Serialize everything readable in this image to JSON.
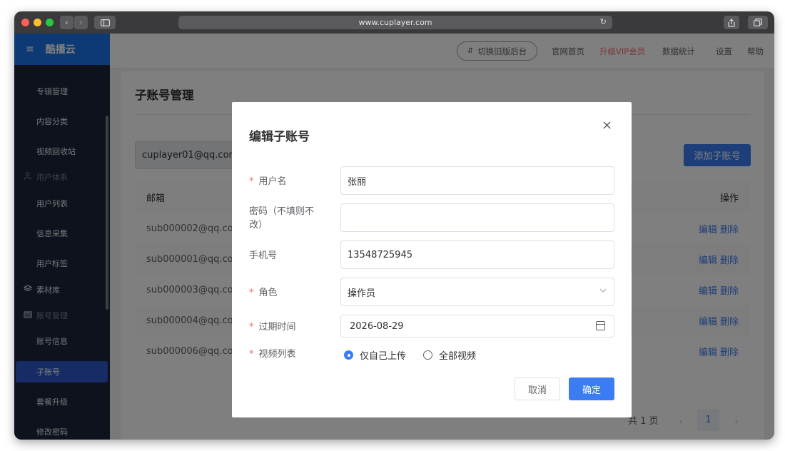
{
  "browser": {
    "url": "www.cuplayer.com",
    "back": "‹",
    "forward": "›"
  },
  "app": {
    "brand": "酷播云",
    "menu_icon": "≡"
  },
  "topnav": {
    "switch_label": "切换旧版后台",
    "links": [
      {
        "label": "官网首页",
        "color": "#606266"
      },
      {
        "label": "升级VIP会员",
        "color": "#f56c6c"
      },
      {
        "label": "数据统计",
        "color": "#606266"
      },
      {
        "label": "设置",
        "color": "#606266"
      },
      {
        "label": "帮助",
        "color": "#606266"
      }
    ]
  },
  "sidebar": {
    "items": [
      {
        "label": "专辑管理"
      },
      {
        "label": "内容分类"
      },
      {
        "label": "视频回收站"
      },
      {
        "label": "用户体系",
        "group": true
      },
      {
        "label": "用户列表"
      },
      {
        "label": "信息采集"
      },
      {
        "label": "用户标签"
      },
      {
        "label": "素材库",
        "group": true
      },
      {
        "label": "账号管理",
        "group": true
      },
      {
        "label": "账号信息"
      },
      {
        "label": "子账号",
        "active": true
      },
      {
        "label": "套餐升级"
      },
      {
        "label": "修改密码"
      }
    ]
  },
  "page": {
    "title": "子账号管理",
    "search_value": "cuplayer01@qq.com",
    "add_button": "添加子账号",
    "table": {
      "headers": [
        "邮箱",
        "操作"
      ],
      "rows": [
        {
          "email": "sub000002@qq.com",
          "edit": "编辑",
          "delete": "删除"
        },
        {
          "email": "sub000001@qq.com",
          "edit": "编辑",
          "delete": "删除"
        },
        {
          "email": "sub000003@qq.com",
          "edit": "编辑",
          "delete": "删除"
        },
        {
          "email": "sub000004@qq.com",
          "edit": "编辑",
          "delete": "删除"
        },
        {
          "email": "sub000006@qq.com",
          "edit": "编辑",
          "delete": "删除"
        }
      ]
    },
    "pager": {
      "total": "共 1 页",
      "current": "1",
      "prev": "‹",
      "next": "›"
    }
  },
  "modal": {
    "title": "编辑子账号",
    "close": "×",
    "fields": {
      "username": {
        "label": "用户名",
        "value": "张丽",
        "required": "*"
      },
      "password": {
        "label": "密码（不填则不改）",
        "label_line1": "密码（不填则不",
        "label_line2": "改）",
        "value": ""
      },
      "phone": {
        "label": "手机号",
        "value": "13548725945"
      },
      "role": {
        "label": "角色",
        "value": "操作员",
        "required": "*"
      },
      "expire": {
        "label": "过期时间",
        "value": "2026-08-29",
        "required": "*"
      },
      "videos": {
        "label": "视频列表",
        "required": "*",
        "options": [
          "仅自己上传",
          "全部视频"
        ],
        "selected": "仅自己上传"
      }
    },
    "cancel": "取消",
    "confirm": "确定"
  }
}
